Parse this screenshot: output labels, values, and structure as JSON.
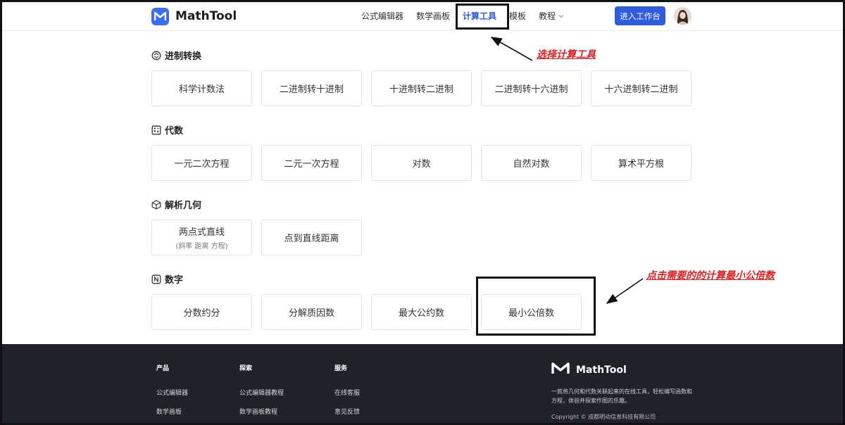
{
  "header": {
    "logo_text": "MathTool",
    "nav": [
      "公式编辑器",
      "数学画板",
      "计算工具",
      "模板",
      "教程"
    ],
    "active_nav": "计算工具",
    "cta_label": "进入工作台"
  },
  "sections": [
    {
      "title": "进制转换",
      "icon": "conversion-icon",
      "items": [
        {
          "label": "科学计数法"
        },
        {
          "label": "二进制转十进制"
        },
        {
          "label": "十进制转二进制"
        },
        {
          "label": "二进制转十六进制"
        },
        {
          "label": "十六进制转二进制"
        }
      ]
    },
    {
      "title": "代数",
      "icon": "calculator-icon",
      "items": [
        {
          "label": "一元二次方程"
        },
        {
          "label": "二元一次方程"
        },
        {
          "label": "对数"
        },
        {
          "label": "自然对数"
        },
        {
          "label": "算术平方根"
        }
      ]
    },
    {
      "title": "解析几何",
      "icon": "cube-icon",
      "items": [
        {
          "label": "两点式直线",
          "sub": "(斜率 距离 方程)"
        },
        {
          "label": "点到直线距离"
        }
      ]
    },
    {
      "title": "数字",
      "icon": "number-icon",
      "items": [
        {
          "label": "分数约分"
        },
        {
          "label": "分解质因数"
        },
        {
          "label": "最大公约数"
        },
        {
          "label": "最小公倍数"
        }
      ]
    }
  ],
  "annotations": {
    "nav_hint": "选择计算工具",
    "card_hint": "点击需要的的计算最小公倍数"
  },
  "footer": {
    "columns": [
      {
        "title": "产品",
        "links": [
          "公式编辑器",
          "数学画板"
        ]
      },
      {
        "title": "探索",
        "links": [
          "公式编辑器教程",
          "数学画板教程"
        ]
      },
      {
        "title": "服务",
        "links": [
          "在线客服",
          "意见反馈"
        ]
      }
    ],
    "brand": "MathTool",
    "description": "一款将几何和代数关联起来的在线工具，轻松编写函数和方程，体验并探索作图的乐趣。",
    "copyright": "Copyright © 成都明动信息科技有限公司"
  },
  "colors": {
    "accent": "#2e5be0",
    "annotation": "#e02020",
    "footer_bg": "#1f2229"
  }
}
